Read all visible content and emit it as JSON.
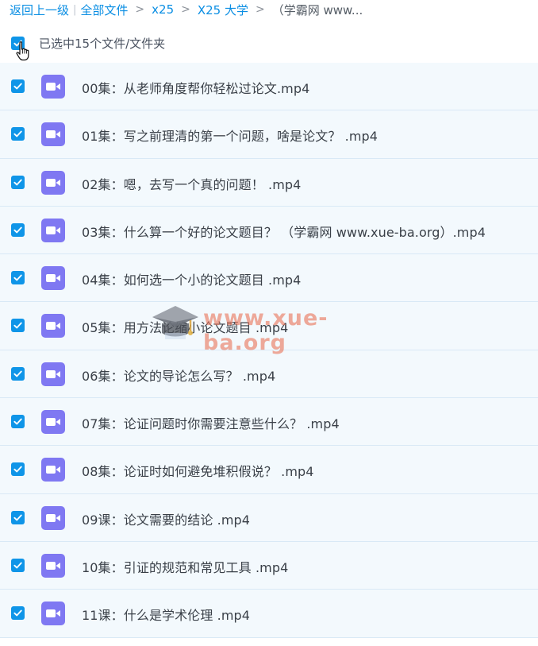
{
  "breadcrumb": {
    "back": "返回上一级",
    "all_files": "全部文件",
    "level1": "x25",
    "level2": "X25 大学",
    "current": "（学霸网 www..."
  },
  "selection": {
    "text": "已选中15个文件/文件夹"
  },
  "files": [
    {
      "name": "00集：从老师角度帮你轻松过论文.mp4"
    },
    {
      "name": "01集：写之前理清的第一个问题，啥是论文？ .mp4"
    },
    {
      "name": "02集：嗯，去写一个真的问题！ .mp4"
    },
    {
      "name": "03集：什么算一个好的论文题目？ （学霸网 www.xue-ba.org）.mp4"
    },
    {
      "name": "04集：如何选一个小的论文题目 .mp4"
    },
    {
      "name": "05集：用方法论缩小论文题目 .mp4"
    },
    {
      "name": "06集：论文的导论怎么写？ .mp4"
    },
    {
      "name": "07集：论证问题时你需要注意些什么？ .mp4"
    },
    {
      "name": "08集：论证时如何避免堆积假说？ .mp4"
    },
    {
      "name": "09课：论文需要的结论 .mp4"
    },
    {
      "name": "10集：引证的规范和常见工具 .mp4"
    },
    {
      "name": "11课：什么是学术伦理 .mp4"
    }
  ],
  "watermark": {
    "text": "www.xue-ba.org"
  },
  "colors": {
    "link": "#0a8ee3",
    "checkbox": "#0f95e8",
    "video_icon": "#7f78f2",
    "row_bg": "#f3f9fd",
    "watermark": "#e8765c"
  },
  "icons": {
    "checkbox": "checkmark-icon",
    "file": "video-camera-icon",
    "cursor": "hand-pointer-icon",
    "watermark": "graduation-cap-icon"
  }
}
